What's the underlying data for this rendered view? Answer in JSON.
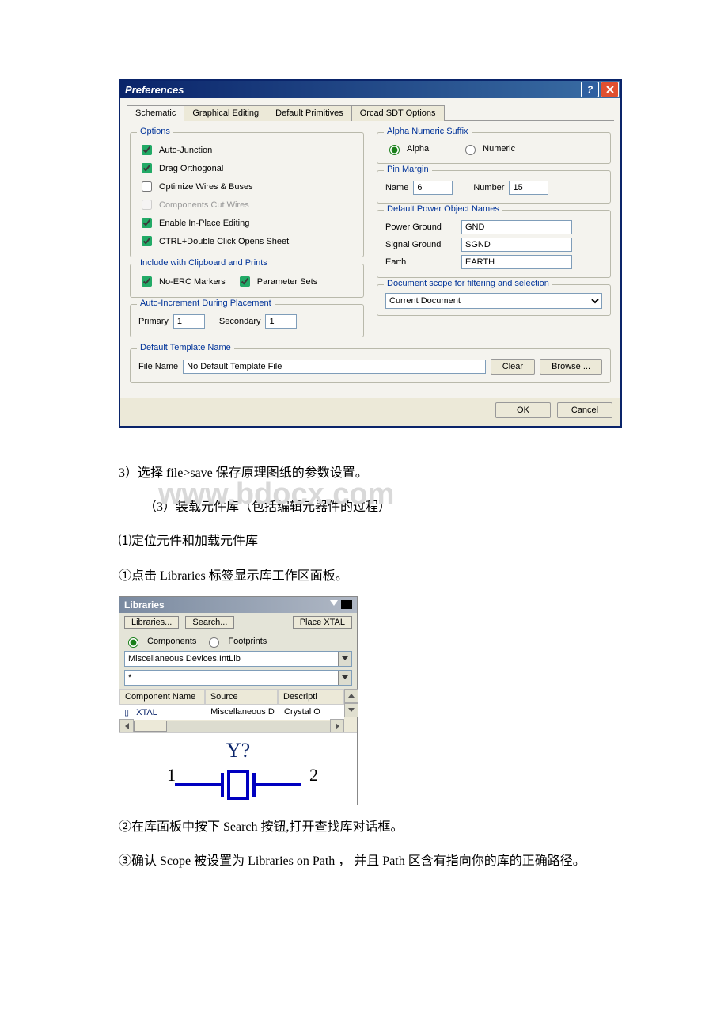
{
  "dialog": {
    "title": "Preferences",
    "tabs": [
      "Schematic",
      "Graphical Editing",
      "Default Primitives",
      "Orcad SDT Options"
    ],
    "options": {
      "legend": "Options",
      "autoJunction": "Auto-Junction",
      "dragOrthogonal": "Drag Orthogonal",
      "optimizeWires": "Optimize Wires & Buses",
      "componentsCutWires": "Components Cut Wires",
      "enableInPlace": "Enable In-Place Editing",
      "ctrlDblClick": "CTRL+Double Click Opens Sheet"
    },
    "clipboard": {
      "legend": "Include with Clipboard and Prints",
      "noErc": "No-ERC Markers",
      "paramSets": "Parameter Sets"
    },
    "autoInc": {
      "legend": "Auto-Increment During Placement",
      "primaryLabel": "Primary",
      "primaryValue": "1",
      "secondaryLabel": "Secondary",
      "secondaryValue": "1"
    },
    "alphaNum": {
      "legend": "Alpha Numeric Suffix",
      "alpha": "Alpha",
      "numeric": "Numeric"
    },
    "pinMargin": {
      "legend": "Pin Margin",
      "nameLabel": "Name",
      "nameValue": "6",
      "numberLabel": "Number",
      "numberValue": "15"
    },
    "powerNames": {
      "legend": "Default Power Object Names",
      "pgLabel": "Power Ground",
      "pgValue": "GND",
      "sgLabel": "Signal Ground",
      "sgValue": "SGND",
      "earthLabel": "Earth",
      "earthValue": "EARTH"
    },
    "docScope": {
      "legend": "Document scope for filtering and selection",
      "value": "Current Document"
    },
    "template": {
      "legend": "Default Template Name",
      "fileNameLabel": "File Name",
      "fileNameValue": "No Default Template File",
      "clear": "Clear",
      "browse": "Browse ..."
    },
    "ok": "OK",
    "cancel": "Cancel"
  },
  "doc": {
    "line1": "3）选择 file>save 保存原理图纸的参数设置。",
    "line2": "（3）装载元件库（包括编辑元器件的过程）",
    "line3": "⑴定位元件和加载元件库",
    "line4": "①点击 Libraries 标签显示库工作区面板。",
    "line5": "②在库面板中按下 Search 按钮,打开查找库对话框。",
    "line6": "③确认 Scope 被设置为 Libraries on Path ， 并且 Path 区含有指向你的库的正确路径。",
    "watermark": "www.bdocx.com"
  },
  "lib": {
    "title": "Libraries",
    "btnLibraries": "Libraries...",
    "btnSearch": "Search...",
    "btnPlace": "Place XTAL",
    "radioComponents": "Components",
    "radioFootprints": "Footprints",
    "selectLib": "Miscellaneous Devices.IntLib",
    "filter": "*",
    "colName": "Component Name",
    "colSource": "Source",
    "colDesc": "Descripti",
    "rowName": "XTAL",
    "rowSource": "Miscellaneous D",
    "rowDesc": "Crystal O",
    "previewDesignator": "Y?",
    "previewPin1": "1",
    "previewPin2": "2"
  }
}
